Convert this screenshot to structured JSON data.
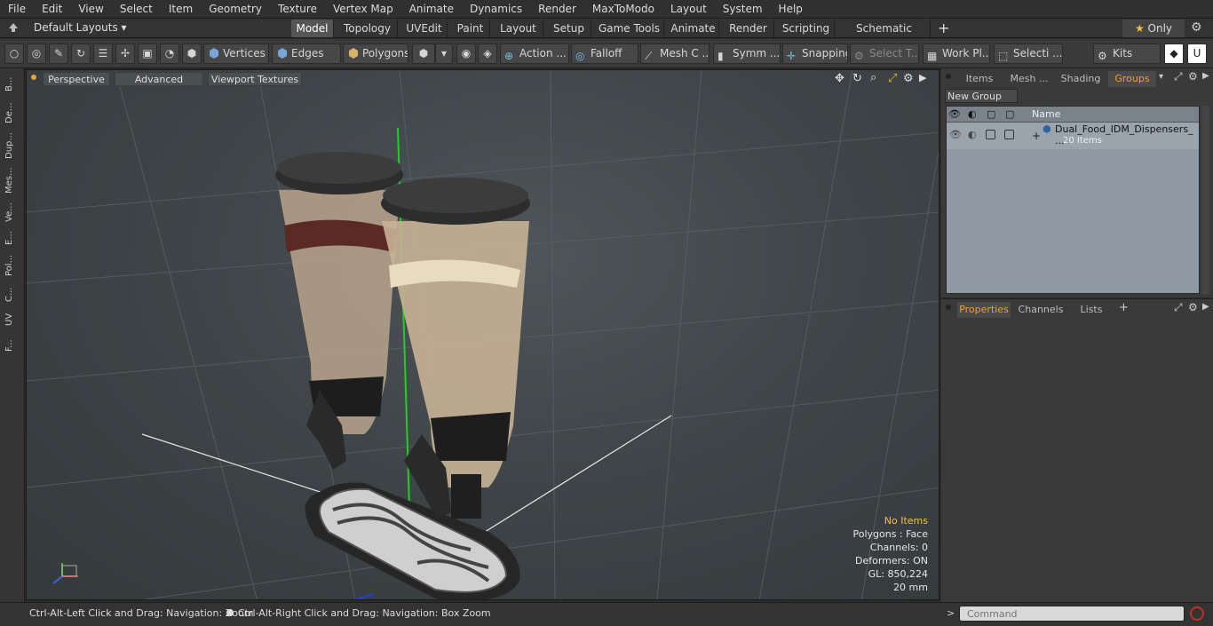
{
  "menu": [
    "File",
    "Edit",
    "View",
    "Select",
    "Item",
    "Geometry",
    "Texture",
    "Vertex Map",
    "Animate",
    "Dynamics",
    "Render",
    "MaxToModo",
    "Layout",
    "System",
    "Help"
  ],
  "layouts": {
    "dropdown": "Default Layouts",
    "tabs": [
      "Model",
      "Topology",
      "UVEdit",
      "Paint",
      "Layout",
      "Setup",
      "Game Tools",
      "Animate",
      "Render",
      "Scripting",
      "Schematic Fusion"
    ],
    "active_tab": "Model",
    "only_label": "Only"
  },
  "toolbar": {
    "vertices": "Vertices",
    "edges": "Edges",
    "polygons": "Polygons",
    "action": "Action",
    "falloff": "Falloff",
    "mesh": "Mesh C ...",
    "symmetry": "Symm ...",
    "snapping": "Snapping",
    "select_t": "Select T...",
    "workplane": "Work Pl...",
    "selection": "Selecti ...",
    "kits": "Kits"
  },
  "left_tabs": [
    "B...",
    "De...",
    "Dup...",
    "Mes...",
    "Ve...",
    "E...",
    "Pol...",
    "C...",
    "UV",
    "F..."
  ],
  "viewport": {
    "perspective": "Perspective",
    "advanced": "Advanced",
    "textures": "Viewport Textures",
    "stats": {
      "no_items": "No Items",
      "polygons": "Polygons : Face",
      "channels": "Channels: 0",
      "deformers": "Deformers: ON",
      "gl": "GL: 850,224",
      "unit": "20 mm"
    }
  },
  "right_top": {
    "tabs": [
      "Items",
      "Mesh ...",
      "Shading",
      "Groups"
    ],
    "active_tab": "Groups",
    "new_group": "New Group",
    "name_header": "Name",
    "group_name": "Dual_Food_IDM_Dispensers_ ...",
    "group_count": "20 Items"
  },
  "right_bottom": {
    "tabs": [
      "Properties",
      "Channels",
      "Lists"
    ],
    "active_tab": "Properties"
  },
  "status": {
    "hint1": "Ctrl-Alt-Left Click and Drag: Navigation: Zoom",
    "hint2": "Ctrl-Alt-Right Click and Drag: Navigation: Box Zoom",
    "command_placeholder": "Command"
  },
  "colors": {
    "accent": "#f0a030",
    "selected_tab": "#555555"
  }
}
